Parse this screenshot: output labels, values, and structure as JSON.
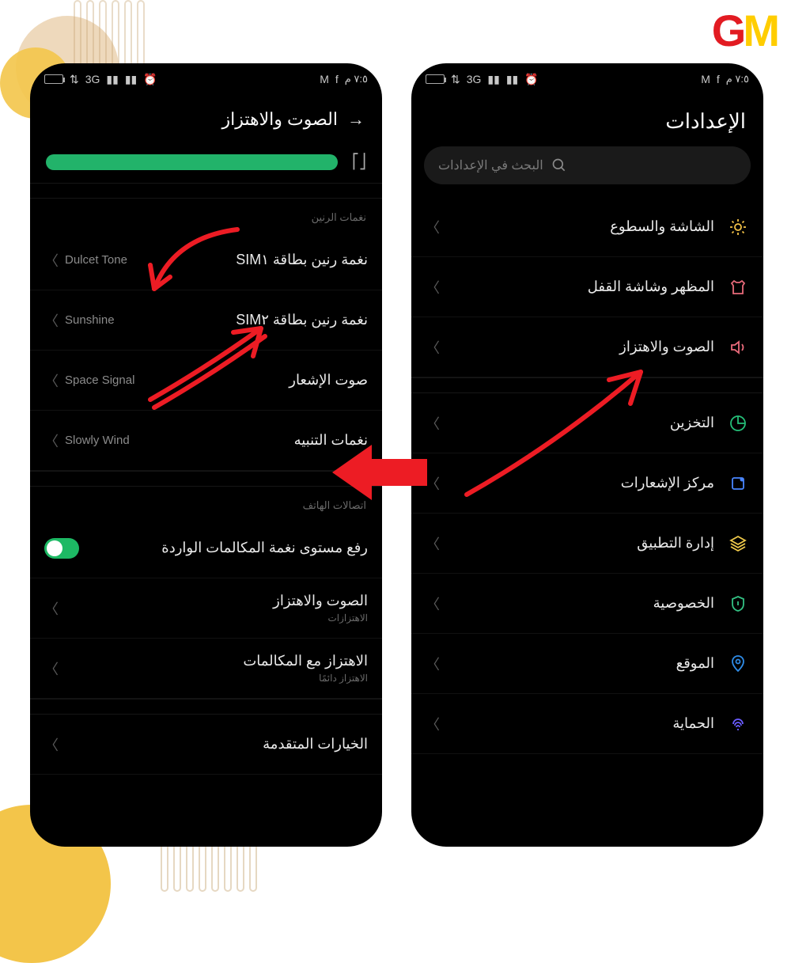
{
  "logo": {
    "g": "G",
    "m": "M"
  },
  "status": {
    "time": "٧:٥ م",
    "icons_right": [
      "M",
      "f"
    ],
    "icons_left": [
      "alarm",
      "signal",
      "3G",
      "signal2",
      "data",
      "battery"
    ]
  },
  "right_phone": {
    "title": "الإعدادات",
    "search_placeholder": "البحث في الإعدادات",
    "items": [
      {
        "label": "الشاشة والسطوع",
        "icon": "sun",
        "color": "#f3c247"
      },
      {
        "label": "المظهر وشاشة القفل",
        "icon": "shirt",
        "color": "#e86a7a"
      },
      {
        "label": "الصوت والاهتزاز",
        "icon": "volume",
        "color": "#e86a7a"
      },
      {
        "label": "التخزين",
        "icon": "chart",
        "color": "#25c079"
      },
      {
        "label": "مركز الإشعارات",
        "icon": "notif",
        "color": "#4a86ff"
      },
      {
        "label": "إدارة التطبيق",
        "icon": "layers",
        "color": "#efc94a"
      },
      {
        "label": "الخصوصية",
        "icon": "shield",
        "color": "#33c083"
      },
      {
        "label": "الموقع",
        "icon": "pin",
        "color": "#2e8be6"
      },
      {
        "label": "الحماية",
        "icon": "fingerprint",
        "color": "#6a5cff"
      }
    ]
  },
  "left_phone": {
    "title": "الصوت والاهتزاز",
    "section_ring": "نغمات الرنين",
    "rows": [
      {
        "label": "نغمة رنين بطاقة SIM١",
        "value": "Dulcet Tone"
      },
      {
        "label": "نغمة رنين بطاقة SIM٢",
        "value": "Sunshine"
      },
      {
        "label": "صوت الإشعار",
        "value": "Space Signal"
      },
      {
        "label": "نغمات التنبيه",
        "value": "Slowly Wind"
      }
    ],
    "section_calls": "اتصالات الهاتف",
    "toggle_row": {
      "label": "رفع مستوى نغمة المكالمات الواردة",
      "on": true
    },
    "sound_vib": {
      "label": "الصوت والاهتزاز",
      "sub": "الاهتزازات"
    },
    "vib_calls": {
      "label": "الاهتزاز مع المكالمات",
      "sub": "الاهتزاز دائمًا"
    },
    "advanced": "الخيارات المتقدمة"
  }
}
